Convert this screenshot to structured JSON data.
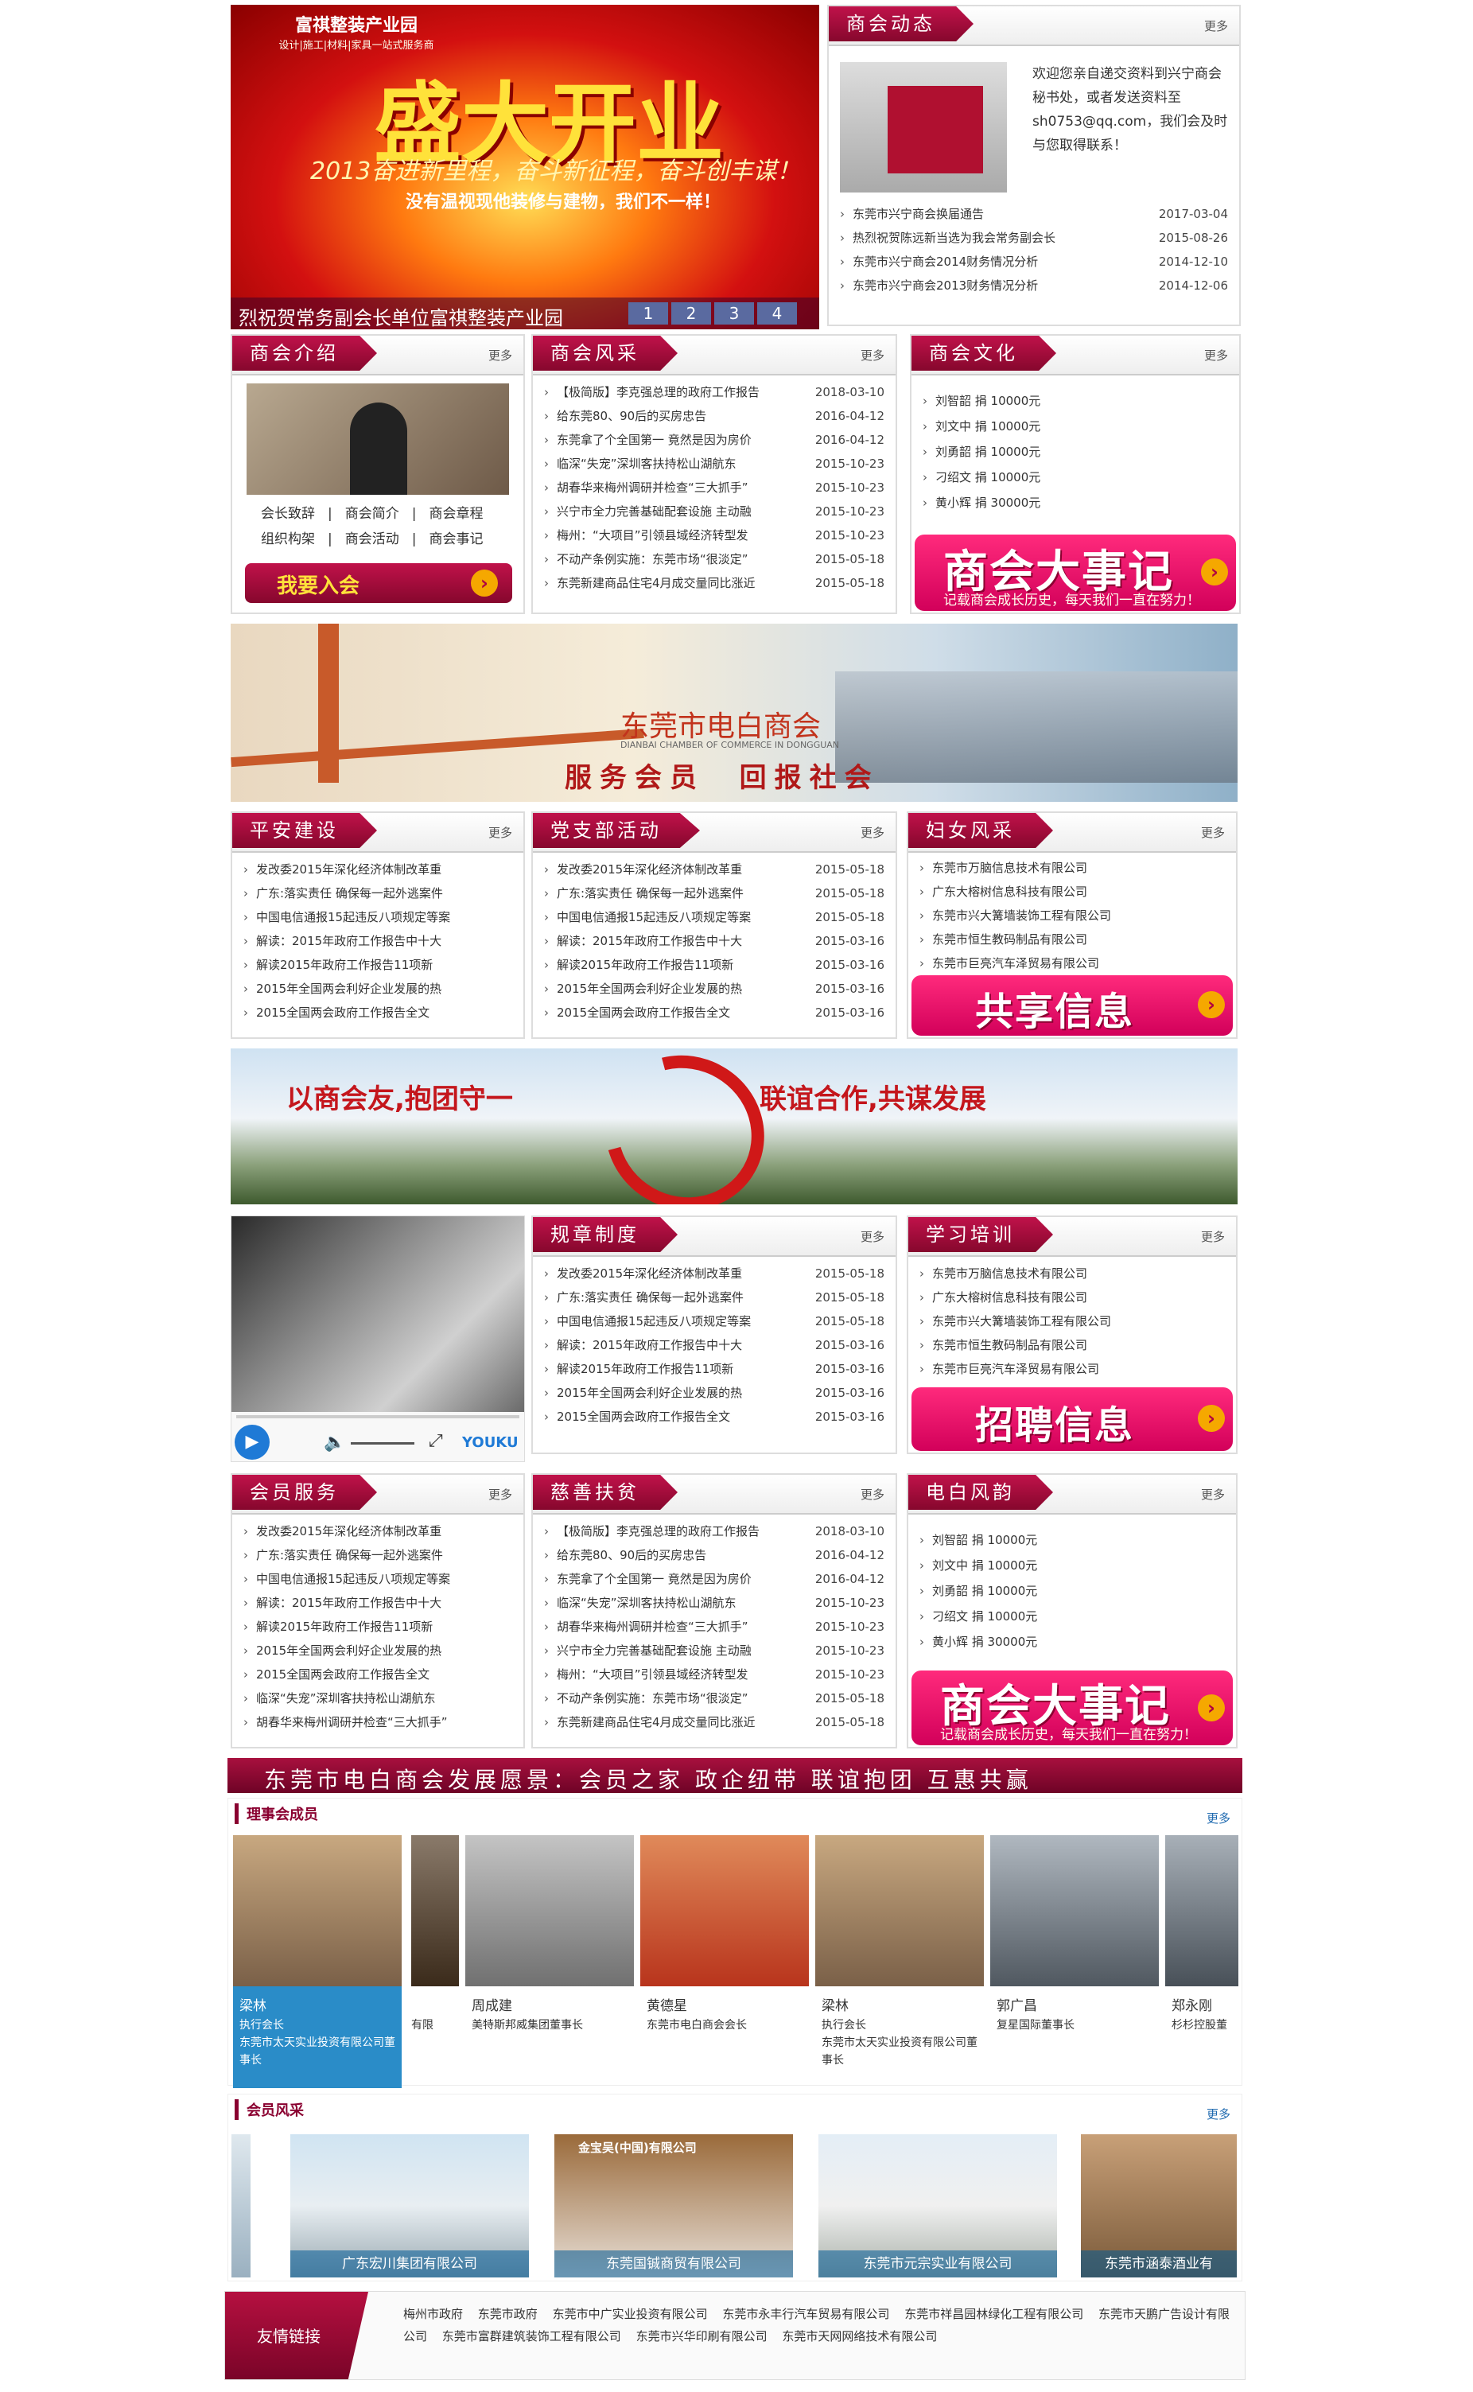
{
  "hero": {
    "title": "盛大开业",
    "tagline": "2013奋进新里程，奋斗新征程，奋斗创丰谋！",
    "slogan": "没有温视现他装修与建物，我们不一样！",
    "logo_text": "富祺整装产业园",
    "logo_sub": "设计|施工|材料|家具一站式服务商",
    "caption": "烈祝贺常务副会长单位富祺整装产业园",
    "pages": [
      "1",
      "2",
      "3",
      "4"
    ]
  },
  "news": {
    "tab": "商会动态",
    "more": "更多",
    "intro": "欢迎您亲自递交资料到兴宁商会秘书处，或者发送资料至sh0753@qq.com，我们会及时与您取得联系！",
    "items": [
      {
        "title": "东莞市兴宁商会换届通告",
        "date": "2017-03-04"
      },
      {
        "title": "热烈祝贺陈远新当选为我会常务副会长",
        "date": "2015-08-26"
      },
      {
        "title": "东莞市兴宁商会2014财务情况分析",
        "date": "2014-12-10"
      },
      {
        "title": "东莞市兴宁商会2013财务情况分析",
        "date": "2014-12-06"
      }
    ]
  },
  "intro": {
    "tab": "商会介绍",
    "more": "更多",
    "links": [
      "会长致辞",
      "商会简介",
      "商会章程",
      "组织构架",
      "商会活动",
      "商会事记"
    ],
    "join": "我要入会"
  },
  "style": {
    "tab": "商会风采",
    "more": "更多",
    "items": [
      {
        "title": "【极简版】李克强总理的政府工作报告",
        "date": "2018-03-10"
      },
      {
        "title": "给东莞80、90后的买房忠告",
        "date": "2016-04-12"
      },
      {
        "title": "东莞拿了个全国第一 竟然是因为房价",
        "date": "2016-04-12"
      },
      {
        "title": "临深“失宠”深圳客扶持松山湖航东",
        "date": "2015-10-23"
      },
      {
        "title": "胡春华来梅州调研并检查“三大抓手”",
        "date": "2015-10-23"
      },
      {
        "title": "兴宁市全力完善基础配套设施 主动融",
        "date": "2015-10-23"
      },
      {
        "title": "梅州：“大项目”引领县域经济转型发",
        "date": "2015-10-23"
      },
      {
        "title": "不动产条例实施：东莞市场“很淡定”",
        "date": "2015-05-18"
      },
      {
        "title": "东莞新建商品住宅4月成交量同比涨近",
        "date": "2015-05-18"
      }
    ]
  },
  "culture": {
    "tab": "商会文化",
    "more": "更多",
    "items": [
      "刘智韶 捐 10000元",
      "刘文中 捐 10000元",
      "刘勇韶 捐 10000元",
      "刁绍文 捐 10000元",
      "黄小辉 捐 30000元"
    ],
    "promo_title": "商会大事记",
    "promo_sub": "记载商会成长历史，每天我们一直在努力！"
  },
  "banner1": {
    "title": "东莞市电白商会",
    "en": "DIANBAI CHAMBER OF COMMERCE IN DONGGUAN",
    "slogan": "服务会员  回报社会"
  },
  "safety": {
    "tab": "平安建设",
    "more": "更多",
    "items": [
      "发改委2015年深化经济体制改革重",
      "广东:落实责任 确保每一起外逃案件",
      "中国电信通报15起违反八项规定等案",
      "解读：2015年政府工作报告中十大",
      "解读2015年政府工作报告11项新",
      "2015年全国两会利好企业发展的热",
      "2015全国两会政府工作报告全文"
    ]
  },
  "party": {
    "tab": "党支部活动",
    "more": "更多",
    "items": [
      {
        "title": "发改委2015年深化经济体制改革重",
        "date": "2015-05-18"
      },
      {
        "title": "广东:落实责任 确保每一起外逃案件",
        "date": "2015-05-18"
      },
      {
        "title": "中国电信通报15起违反八项规定等案",
        "date": "2015-05-18"
      },
      {
        "title": "解读：2015年政府工作报告中十大",
        "date": "2015-03-16"
      },
      {
        "title": "解读2015年政府工作报告11项新",
        "date": "2015-03-16"
      },
      {
        "title": "2015年全国两会利好企业发展的热",
        "date": "2015-03-16"
      },
      {
        "title": "2015全国两会政府工作报告全文",
        "date": "2015-03-16"
      }
    ]
  },
  "women": {
    "tab": "妇女风采",
    "more": "更多",
    "items": [
      "东莞市万脑信息技术有限公司",
      "广东大榕树信息科技有限公司",
      "东莞市兴大篝墙装饰工程有限公司",
      "东莞市恒生教码制品有限公司",
      "东莞市巨亮汽车泽贸易有限公司"
    ],
    "promo_title": "共享信息"
  },
  "banner2": {
    "left": "以商会友,抱团守一",
    "right": "联谊合作,共谋发展"
  },
  "video": {
    "brand": "YOUKU"
  },
  "rules": {
    "tab": "规章制度",
    "more": "更多",
    "items": [
      {
        "title": "发改委2015年深化经济体制改革重",
        "date": "2015-05-18"
      },
      {
        "title": "广东:落实责任 确保每一起外逃案件",
        "date": "2015-05-18"
      },
      {
        "title": "中国电信通报15起违反八项规定等案",
        "date": "2015-05-18"
      },
      {
        "title": "解读：2015年政府工作报告中十大",
        "date": "2015-03-16"
      },
      {
        "title": "解读2015年政府工作报告11项新",
        "date": "2015-03-16"
      },
      {
        "title": "2015年全国两会利好企业发展的热",
        "date": "2015-03-16"
      },
      {
        "title": "2015全国两会政府工作报告全文",
        "date": "2015-03-16"
      }
    ]
  },
  "training": {
    "tab": "学习培训",
    "more": "更多",
    "items": [
      "东莞市万脑信息技术有限公司",
      "广东大榕树信息科技有限公司",
      "东莞市兴大篝墙装饰工程有限公司",
      "东莞市恒生教码制品有限公司",
      "东莞市巨亮汽车泽贸易有限公司"
    ],
    "promo_title": "招聘信息"
  },
  "member_service": {
    "tab": "会员服务",
    "more": "更多",
    "items": [
      "发改委2015年深化经济体制改革重",
      "广东:落实责任 确保每一起外逃案件",
      "中国电信通报15起违反八项规定等案",
      "解读：2015年政府工作报告中十大",
      "解读2015年政府工作报告11项新",
      "2015年全国两会利好企业发展的热",
      "2015全国两会政府工作报告全文",
      "临深“失宠”深圳客扶持松山湖航东",
      "胡春华来梅州调研并检查“三大抓手”"
    ]
  },
  "charity": {
    "tab": "慈善扶贫",
    "more": "更多",
    "items": [
      {
        "title": "【极简版】李克强总理的政府工作报告",
        "date": "2018-03-10"
      },
      {
        "title": "给东莞80、90后的买房忠告",
        "date": "2016-04-12"
      },
      {
        "title": "东莞拿了个全国第一 竟然是因为房价",
        "date": "2016-04-12"
      },
      {
        "title": "临深“失宠”深圳客扶持松山湖航东",
        "date": "2015-10-23"
      },
      {
        "title": "胡春华来梅州调研并检查“三大抓手”",
        "date": "2015-10-23"
      },
      {
        "title": "兴宁市全力完善基础配套设施 主动融",
        "date": "2015-10-23"
      },
      {
        "title": "梅州：“大项目”引领县域经济转型发",
        "date": "2015-10-23"
      },
      {
        "title": "不动产条例实施：东莞市场“很淡定”",
        "date": "2015-05-18"
      },
      {
        "title": "东莞新建商品住宅4月成交量同比涨近",
        "date": "2015-05-18"
      }
    ]
  },
  "dianbai": {
    "tab": "电白风韵",
    "more": "更多",
    "items": [
      "刘智韶 捐 10000元",
      "刘文中 捐 10000元",
      "刘勇韶 捐 10000元",
      "刁绍文 捐 10000元",
      "黄小辉 捐 30000元"
    ],
    "promo_title": "商会大事记",
    "promo_sub": "记载商会成长历史，每天我们一直在努力！"
  },
  "vision": "东莞市电白商会发展愿景：会员之家 政企纽带 联谊抱团 互惠共赢",
  "directors": {
    "title": "理事会成员",
    "more": "更多",
    "people": [
      {
        "name": "梁林",
        "role": "执行会长",
        "company": "东莞市太天实业投资有限公司董事长"
      },
      {
        "name": "",
        "role": "",
        "company": "有限"
      },
      {
        "name": "周成建",
        "role": "",
        "company": "美特斯邦威集团董事长"
      },
      {
        "name": "黄德星",
        "role": "",
        "company": "东莞市电白商会会长"
      },
      {
        "name": "梁林",
        "role": "执行会长",
        "company": "东莞市太天实业投资有限公司董事长"
      },
      {
        "name": "郭广昌",
        "role": "",
        "company": "复星国际董事长"
      },
      {
        "name": "郑永刚",
        "role": "",
        "company": "杉杉控股董"
      }
    ]
  },
  "members": {
    "title": "会员风采",
    "more": "更多",
    "companies": [
      "广东宏川集团有限公司",
      "东莞国铖商贸有限公司",
      "东莞市元宗实业有限公司",
      "东莞市涵泰酒业有"
    ],
    "sign": "金宝吴(中国)有限公司"
  },
  "friends": {
    "title": "友情链接",
    "links": [
      "梅州市政府",
      "东莞市政府",
      "东莞市中广实业投资有限公司",
      "东莞市永丰行汽车贸易有限公司",
      "东莞市祥昌园林绿化工程有限公司",
      "东莞市天鹏广告设计有限公司",
      "东莞市富群建筑装饰工程有限公司",
      "东莞市兴华印刷有限公司",
      "东莞市天网网络技术有限公司"
    ]
  },
  "colors": {
    "brand": "#8a0030",
    "accent": "#e0006a",
    "arrow": "#f5a800"
  }
}
